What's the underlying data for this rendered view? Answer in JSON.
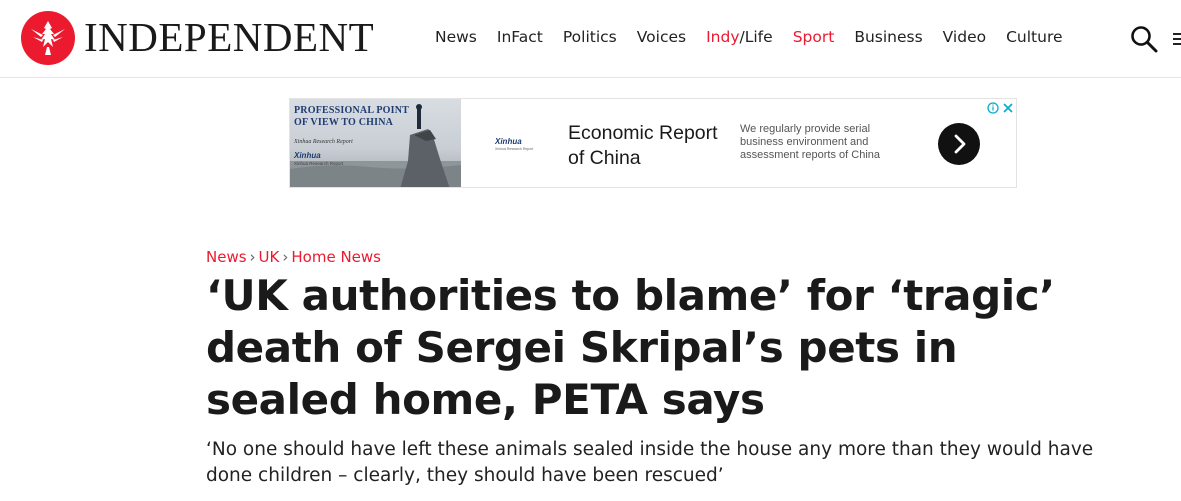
{
  "header": {
    "logo_text": "INDEPENDENT",
    "brand_color": "#ec1a2e",
    "nav": [
      {
        "label": "News"
      },
      {
        "label": "InFact"
      },
      {
        "label": "Politics"
      },
      {
        "label": "Voices"
      },
      {
        "label_a": "Indy",
        "label_b": "/Life"
      },
      {
        "label": "Sport"
      },
      {
        "label": "Business"
      },
      {
        "label": "Video"
      },
      {
        "label": "Culture"
      }
    ],
    "search_icon": "search-icon"
  },
  "ad": {
    "image_title": "PROFESSIONAL POINT OF VIEW TO CHINA",
    "image_subtitle": "Xinhua Research Report",
    "image_brand": "Xinhua",
    "image_brand_sub": "Xinhua Research Report",
    "brand": "Xinhua",
    "brand_sub": "Xinhua Research Report",
    "headline": "Economic Report of China",
    "copy": "We regularly provide serial business environment and assessment reports of China",
    "cta_icon": "chevron-right-icon"
  },
  "article": {
    "breadcrumb": [
      "News",
      "UK",
      "Home News"
    ],
    "breadcrumb_sep": "›",
    "headline": "‘UK authorities to blame’ for ‘tragic’ death of Sergei Skripal’s pets in sealed home, PETA says",
    "standfirst": "‘No one should have left these animals sealed inside the house any more than they would have done children – clearly, they should have been rescued’"
  }
}
